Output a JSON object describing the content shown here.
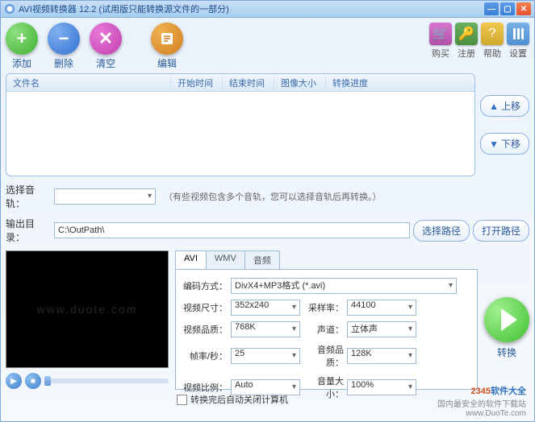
{
  "window": {
    "title": "AVI视频转换器 12.2 (试用版只能转换源文件的一部分)"
  },
  "toolbar": {
    "add": "添加",
    "delete": "删除",
    "clear": "清空",
    "edit": "编辑"
  },
  "right_toolbar": {
    "buy": "购买",
    "register": "注册",
    "help": "帮助",
    "settings": "设置"
  },
  "file_list": {
    "columns": {
      "filename": "文件名",
      "start_time": "开始时间",
      "end_time": "结束时间",
      "image_size": "图像大小",
      "progress": "转换进度"
    },
    "rows": []
  },
  "move": {
    "up": "上移",
    "down": "下移"
  },
  "track": {
    "label": "选择音轨：",
    "value": "",
    "hint": "（有些视频包含多个音轨，您可以选择音轨后再转换。）"
  },
  "output": {
    "label": "输出目录：",
    "path": "C:\\OutPath\\",
    "choose_btn": "选择路径",
    "open_btn": "打开路径"
  },
  "tabs": {
    "avi": "AVI",
    "wmv": "WMV",
    "audio": "音频",
    "active": "avi"
  },
  "settings": {
    "encode_label": "编码方式：",
    "encode_value": "DivX4+MP3格式 (*.avi)",
    "size_label": "视频尺寸：",
    "size_value": "352x240",
    "sample_label": "采样率：",
    "sample_value": "44100",
    "vquality_label": "视频品质：",
    "vquality_value": "768K",
    "channel_label": "声道：",
    "channel_value": "立体声",
    "fps_label": "帧率/秒：",
    "fps_value": "25",
    "aquality_label": "音频品质：",
    "aquality_value": "128K",
    "ratio_label": "视频比例：",
    "ratio_value": "Auto",
    "volume_label": "音量大小：",
    "volume_value": "100%"
  },
  "shutdown_checkbox": "转换完后自动关闭计算机",
  "convert": "转换",
  "brand": {
    "logo_num": "2345",
    "logo_text": "软件大全",
    "tagline": "国内最安全的软件下载站",
    "url": "www.DuoTe.com"
  },
  "watermark": "www.duote.com"
}
